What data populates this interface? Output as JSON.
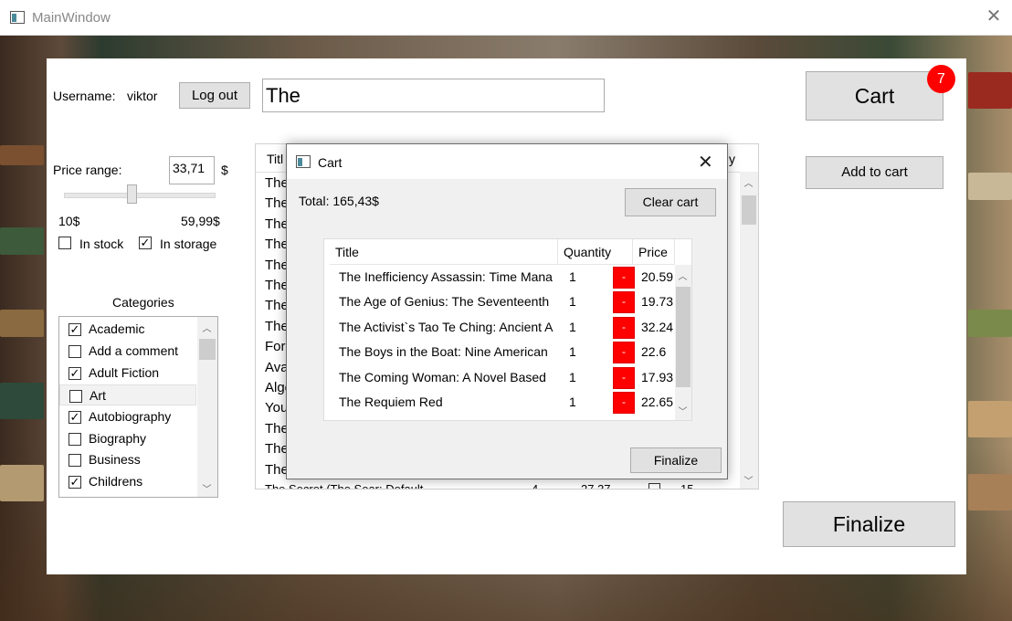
{
  "window": {
    "title": "MainWindow"
  },
  "header": {
    "username_label": "Username:",
    "username": "viktor",
    "logout_label": "Log out",
    "search_value": "The",
    "cart_label": "Cart",
    "cart_count": "7",
    "add_to_cart_label": "Add to cart",
    "finalize_label": "Finalize"
  },
  "filters": {
    "price_range_label": "Price range:",
    "price_value": "33,71",
    "currency": "$",
    "min_label": "10$",
    "max_label": "59,99$",
    "in_stock_label": "In stock",
    "in_stock_checked": false,
    "in_storage_label": "In storage",
    "in_storage_checked": true,
    "categories_label": "Categories",
    "slider_level": 0.45
  },
  "categories": [
    {
      "label": "Academic",
      "checked": true
    },
    {
      "label": "Add a comment",
      "checked": false
    },
    {
      "label": "Adult Fiction",
      "checked": true
    },
    {
      "label": "Art",
      "checked": false
    },
    {
      "label": "Autobiography",
      "checked": true
    },
    {
      "label": "Biography",
      "checked": false
    },
    {
      "label": "Business",
      "checked": false
    },
    {
      "label": "Childrens",
      "checked": true
    }
  ],
  "books_grid": {
    "header_title": "Titl",
    "header_last": "y",
    "rows": [
      "The",
      "The",
      "The",
      "The",
      "The",
      "The",
      "The",
      "The",
      "Fore",
      "Ava",
      "Alge",
      "You",
      "The",
      "The",
      "The"
    ],
    "partial_row": {
      "title": "The Secret (The Sear: Default",
      "quantity": "4",
      "price": "27.37",
      "stock": "15"
    }
  },
  "cart_dialog": {
    "title": "Cart",
    "total": "Total: 165,43$",
    "clear_label": "Clear cart",
    "finalize_label": "Finalize",
    "columns": [
      "Title",
      "Quantity",
      "Price"
    ],
    "remove_label": "-",
    "items": [
      {
        "title": "The Inefficiency Assassin: Time Mana",
        "quantity": "1",
        "price": "20.59"
      },
      {
        "title": "The Age of Genius: The Seventeenth",
        "quantity": "1",
        "price": "19.73"
      },
      {
        "title": "The Activist`s Tao Te Ching: Ancient A",
        "quantity": "1",
        "price": "32.24"
      },
      {
        "title": "The Boys in the Boat: Nine American",
        "quantity": "1",
        "price": "22.6"
      },
      {
        "title": "The Coming Woman: A Novel Based",
        "quantity": "1",
        "price": "17.93"
      },
      {
        "title": "The Requiem Red",
        "quantity": "1",
        "price": "22.65"
      }
    ]
  }
}
